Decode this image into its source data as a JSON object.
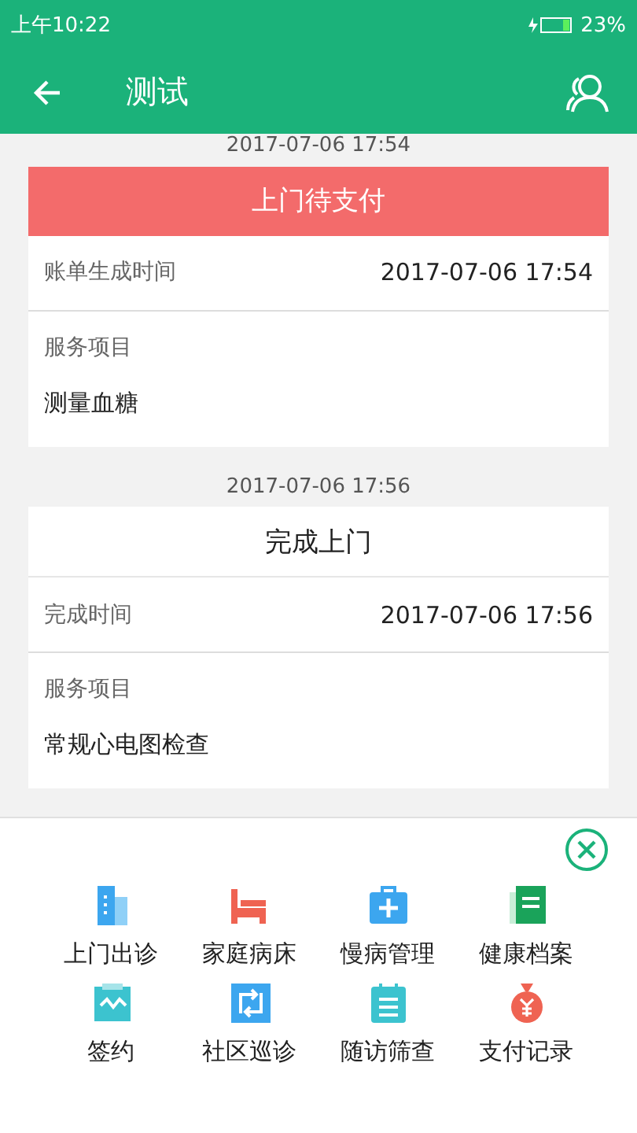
{
  "status_bar": {
    "time": "上午10:22",
    "battery": "23%"
  },
  "app_bar": {
    "title": "测试"
  },
  "records": [
    {
      "date": "2017-07-06 17:54",
      "status": "上门待支付",
      "kind": "alert",
      "time_label": "账单生成时间",
      "time_value": "2017-07-06 17:54",
      "service_label": "服务项目",
      "service_value": "测量血糖"
    },
    {
      "date": "2017-07-06 17:56",
      "status": "完成上门",
      "kind": "plain",
      "time_label": "完成时间",
      "time_value": "2017-07-06 17:56",
      "service_label": "服务项目",
      "service_value": "常规心电图检查"
    }
  ],
  "menu": [
    {
      "label": "上门出诊",
      "kind": "building"
    },
    {
      "label": "家庭病床",
      "kind": "bed"
    },
    {
      "label": "慢病管理",
      "kind": "medkit"
    },
    {
      "label": "健康档案",
      "kind": "document"
    },
    {
      "label": "签约",
      "kind": "clipboard"
    },
    {
      "label": "社区巡诊",
      "kind": "cycle"
    },
    {
      "label": "随访筛查",
      "kind": "notepad"
    },
    {
      "label": "支付记录",
      "kind": "moneybag"
    }
  ]
}
